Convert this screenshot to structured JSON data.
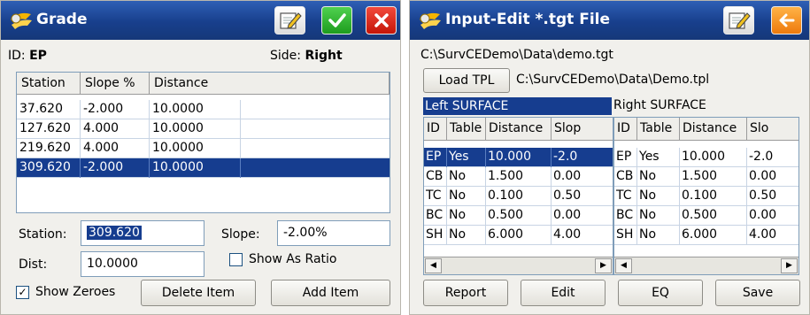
{
  "grade": {
    "title": "Grade",
    "id_label": "ID:",
    "id_value": "EP",
    "side_label": "Side:",
    "side_value": "Right",
    "columns": [
      "Station",
      "Slope %",
      "Distance"
    ],
    "rows": [
      {
        "station": "37.620",
        "slope": "-2.000",
        "distance": "10.0000"
      },
      {
        "station": "127.620",
        "slope": "4.000",
        "distance": "10.0000"
      },
      {
        "station": "219.620",
        "slope": "4.000",
        "distance": "10.0000"
      },
      {
        "station": "309.620",
        "slope": "-2.000",
        "distance": "10.0000"
      }
    ],
    "selected_row": 3,
    "station_label": "Station:",
    "station_value": "309.620",
    "slope_label": "Slope:",
    "slope_value": "-2.00%",
    "dist_label": "Dist:",
    "dist_value": "10.0000",
    "show_as_ratio_label": "Show As Ratio",
    "show_as_ratio_checked": false,
    "show_zeroes_label": "Show Zeroes",
    "show_zeroes_checked": true,
    "delete_item_label": "Delete Item",
    "add_item_label": "Add Item"
  },
  "input_edit": {
    "title": "Input-Edit *.tgt File",
    "file_path": "C:\\SurvCEDemo\\Data\\demo.tgt",
    "load_tpl_label": "Load TPL",
    "tpl_path": "C:\\SurvCEDemo\\Data\\Demo.tpl",
    "left_surface_label": "Left SURFACE",
    "right_surface_label": "Right SURFACE",
    "left_columns": [
      "ID",
      "Table",
      "Distance",
      "Slop"
    ],
    "right_columns": [
      "ID",
      "Table",
      "Distance",
      "Slo"
    ],
    "left_rows": [
      {
        "id": "EP",
        "table": "Yes",
        "distance": "10.000",
        "slope": "-2.0"
      },
      {
        "id": "CB",
        "table": "No",
        "distance": "1.500",
        "slope": "0.00"
      },
      {
        "id": "TC",
        "table": "No",
        "distance": "0.100",
        "slope": "0.50"
      },
      {
        "id": "BC",
        "table": "No",
        "distance": "0.500",
        "slope": "0.00"
      },
      {
        "id": "SH",
        "table": "No",
        "distance": "6.000",
        "slope": "4.00"
      }
    ],
    "right_rows": [
      {
        "id": "EP",
        "table": "Yes",
        "distance": "10.000",
        "slope": "-2.0"
      },
      {
        "id": "CB",
        "table": "No",
        "distance": "1.500",
        "slope": "0.00"
      },
      {
        "id": "TC",
        "table": "No",
        "distance": "0.100",
        "slope": "0.50"
      },
      {
        "id": "BC",
        "table": "No",
        "distance": "0.500",
        "slope": "0.00"
      },
      {
        "id": "SH",
        "table": "No",
        "distance": "6.000",
        "slope": "4.00"
      }
    ],
    "left_selected_row": 0,
    "buttons": {
      "report": "Report",
      "edit": "Edit",
      "eq": "EQ",
      "save": "Save"
    }
  },
  "icons": {
    "app_logo": "app-logo-icon",
    "edit": "edit-notepad-icon",
    "ok": "checkmark-icon",
    "cancel": "close-icon",
    "back": "back-arrow-icon"
  },
  "colors": {
    "titlebar": "#183f8c",
    "selection": "#163d8f",
    "window_bg": "#f1f0ec",
    "ok_green": "#1e9c1e",
    "cancel_red": "#c41508",
    "back_orange": "#ee7a0c"
  }
}
